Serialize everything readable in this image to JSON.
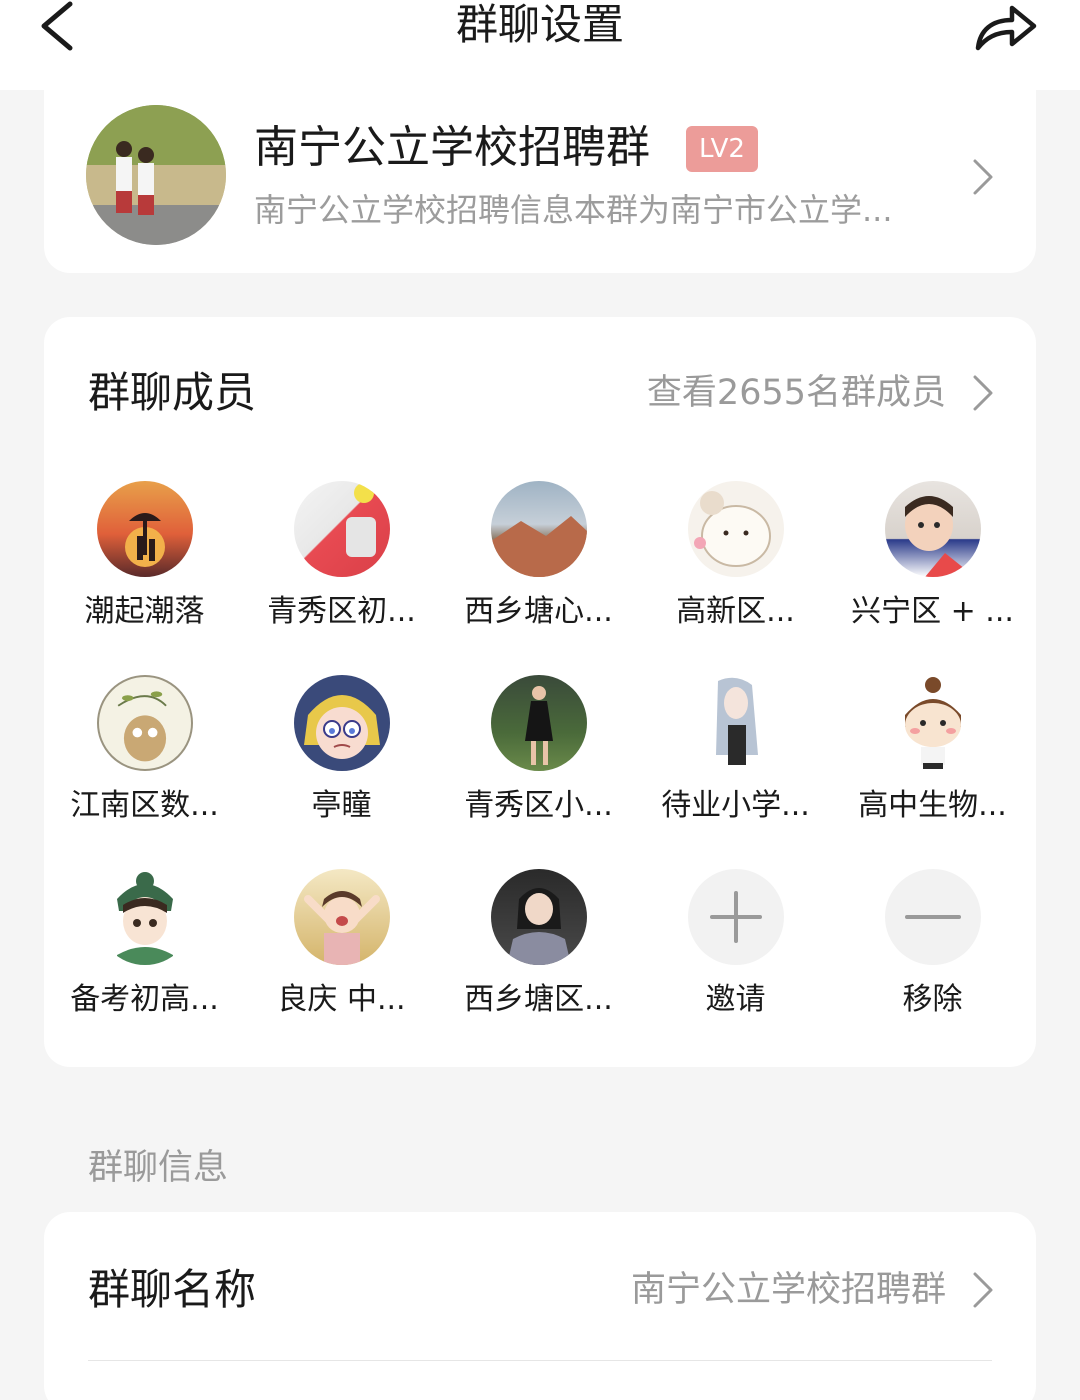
{
  "header": {
    "title": "群聊设置",
    "back_icon": "chevron-left-icon",
    "share_icon": "share-arrow-icon"
  },
  "group": {
    "name": "南宁公立学校招聘群",
    "level": "LV2",
    "description": "南宁公立学校招聘信息本群为南宁市公立学..."
  },
  "members": {
    "title": "群聊成员",
    "view_all": "查看2655名群成员",
    "items": [
      {
        "name": "潮起潮落"
      },
      {
        "name": "青秀区初..."
      },
      {
        "name": "西乡塘心..."
      },
      {
        "name": "高新区..."
      },
      {
        "name": "兴宁区 + ..."
      },
      {
        "name": "江南区数..."
      },
      {
        "name": "亭瞳"
      },
      {
        "name": "青秀区小..."
      },
      {
        "name": "待业小学..."
      },
      {
        "name": "高中生物..."
      },
      {
        "name": "备考初高..."
      },
      {
        "name": "良庆 中..."
      },
      {
        "name": "西乡塘区..."
      }
    ],
    "invite_label": "邀请",
    "remove_label": "移除"
  },
  "info": {
    "section_label": "群聊信息",
    "name_row_label": "群聊名称",
    "name_row_value": "南宁公立学校招聘群"
  },
  "colors": {
    "background": "#f5f5f5",
    "card": "#ffffff",
    "level_badge": "#ec9c99",
    "secondary_text": "#9a9a9a"
  }
}
